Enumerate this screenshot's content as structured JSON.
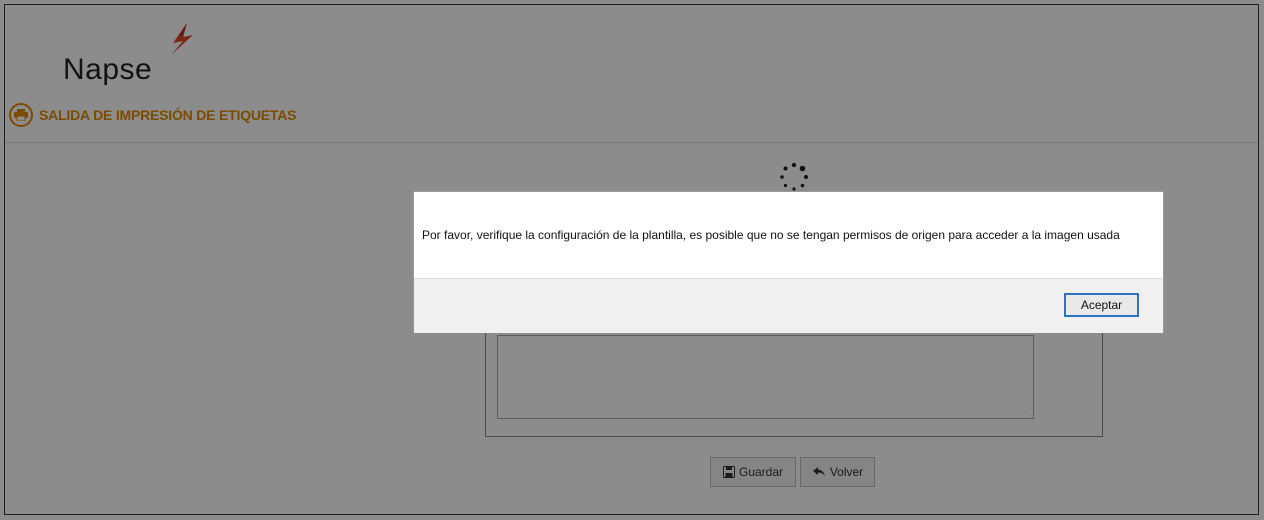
{
  "app": {
    "logo_text": "Napse"
  },
  "page": {
    "title": "SALIDA DE IMPRESIÓN DE ETIQUETAS"
  },
  "actions": {
    "save_label": "Guardar",
    "back_label": "Volver"
  },
  "modal": {
    "message": "Por favor, verifique la configuración de la plantilla, es posible que no se tengan permisos de origen para acceder a la imagen usada",
    "accept_label": "Aceptar"
  },
  "colors": {
    "accent": "#e08a00",
    "logo_mark": "#e04a2a",
    "focus": "#2f73c6"
  },
  "icons": {
    "header": "printer-icon",
    "save": "floppy-disk-icon",
    "back": "reply-arrow-icon",
    "loading": "spinner-icon"
  }
}
